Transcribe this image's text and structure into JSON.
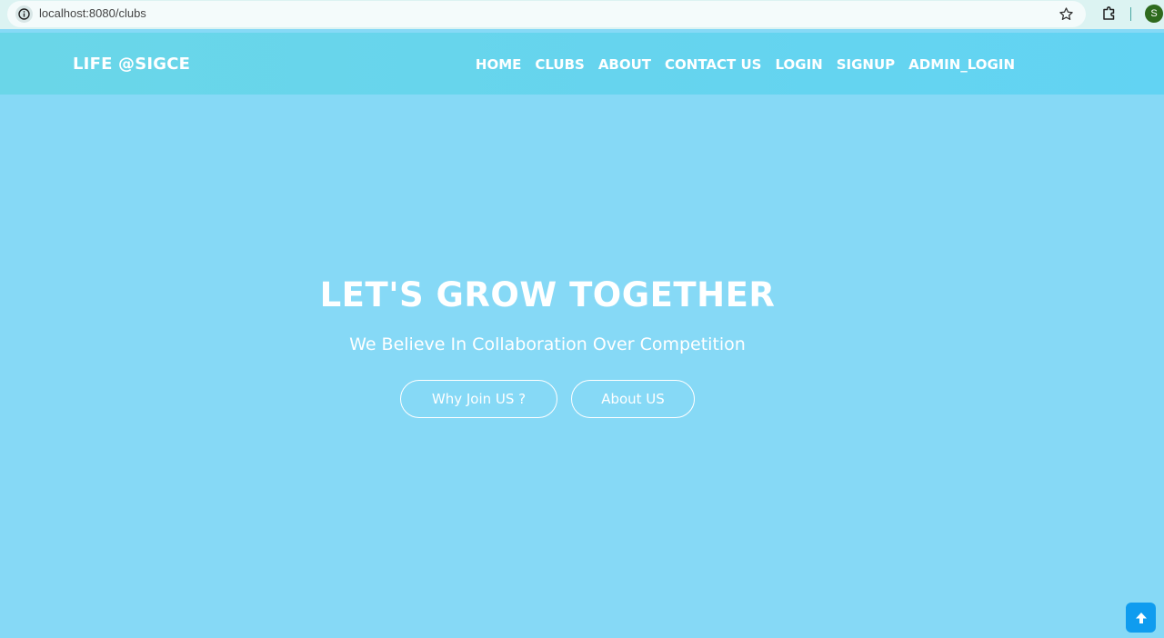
{
  "browser": {
    "url": "localhost:8080/clubs",
    "profile_initial": "S"
  },
  "navbar": {
    "brand": "LIFE @SIGCE",
    "links": [
      {
        "label": "HOME"
      },
      {
        "label": "CLUBS"
      },
      {
        "label": "ABOUT"
      },
      {
        "label": "CONTACT US"
      },
      {
        "label": "LOGIN"
      },
      {
        "label": "SIGNUP"
      },
      {
        "label": "ADMIN_LOGIN"
      }
    ]
  },
  "hero": {
    "title": "LET'S GROW TOGETHER",
    "subtitle": "We Believe In Collaboration Over Competition",
    "buttons": {
      "why_join": "Why Join US ?",
      "about": "About US"
    }
  },
  "icons": {
    "info": "info-icon",
    "star": "star-icon",
    "extensions": "puzzle-icon",
    "scroll_top": "arrow-up-icon"
  },
  "colors": {
    "page_background": "#86d9f6",
    "navbar": "#64d4ee",
    "scroll_top_button": "#0f9cef",
    "avatar": "#2e6a1e"
  }
}
